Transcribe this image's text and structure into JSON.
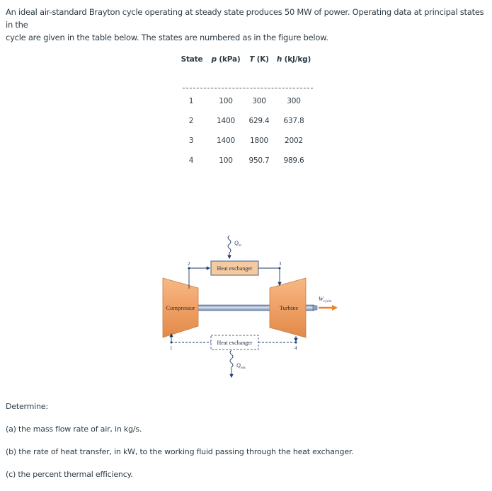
{
  "intro": {
    "line1": "An ideal air-standard Brayton cycle operating at steady state produces 50 MW of power. Operating data at principal states in the",
    "line2": "cycle are given in the table below. The states are numbered as in the figure below."
  },
  "table": {
    "headers": [
      {
        "italic": "",
        "rest": "State"
      },
      {
        "italic": "p",
        "rest": " (kPa)"
      },
      {
        "italic": "T",
        "rest": " (K)"
      },
      {
        "italic": "h",
        "rest": " (kJ/kg)"
      }
    ],
    "rows": [
      [
        "1",
        "100",
        "300",
        "300"
      ],
      [
        "2",
        "1400",
        "629.4",
        "637.8"
      ],
      [
        "3",
        "1400",
        "1800",
        "2002"
      ],
      [
        "4",
        "100",
        "950.7",
        "989.6"
      ]
    ]
  },
  "diagram": {
    "compressor_label": "Compressor",
    "turbine_label": "Turbine",
    "hx_top_label": "Heat exchanger",
    "hx_bottom_label": "Heat exchanger",
    "q_in_symbol": "Q",
    "q_in_sub": "in",
    "q_out_symbol": "Q",
    "q_out_sub": "out",
    "w_symbol": "W",
    "w_sub": "cycle",
    "state_labels": [
      "1",
      "2",
      "3",
      "4"
    ],
    "colors": {
      "component_fill": "#f0a870",
      "component_edge": "#c97a3e",
      "hx_fill": "#f6caa0",
      "line": "#1f3a6e",
      "shaft": "#8fa3c0",
      "work_arrow": "#f08020"
    }
  },
  "questions": {
    "determine": "Determine:",
    "a": "(a) the mass flow rate of air, in kg/s.",
    "b": "(b) the rate of heat transfer, in kW, to the working fluid passing through the heat exchanger.",
    "c": "(c) the percent thermal efficiency."
  }
}
